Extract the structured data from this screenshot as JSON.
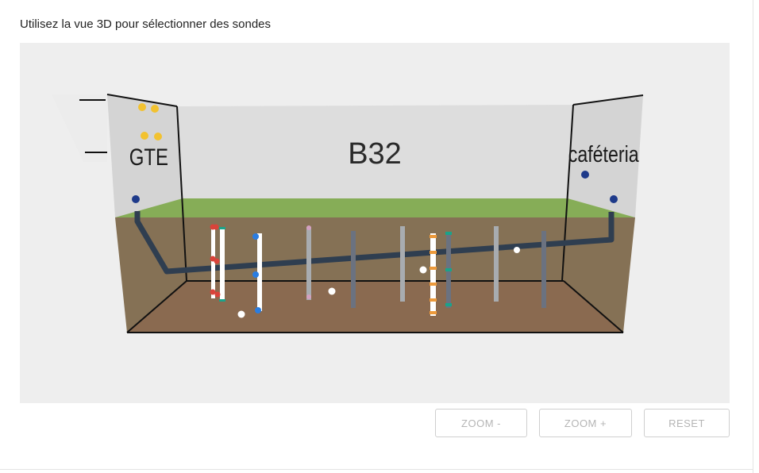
{
  "instruction": "Utilisez la vue 3D pour sélectionner des sondes",
  "scene": {
    "room_label": "B32",
    "left_label": "GTE",
    "right_label": "caféteria"
  },
  "toolbar": {
    "zoom_out_label": "ZOOM -",
    "zoom_in_label": "ZOOM +",
    "reset_label": "RESET"
  },
  "colors": {
    "viewport_bg": "#eeeeee",
    "wall": "#d6d6d6",
    "grass": "#8ab05a",
    "soil": "#8c7256",
    "pipe": "#2f3e50",
    "marker_yellow": "#f2c230",
    "marker_blue": "#1e3a8a",
    "probe_white": "#ffffff",
    "probe_red": "#d9433a",
    "probe_teal": "#1aa38a",
    "probe_blue": "#2a7de1",
    "probe_pink": "#d3a0c0",
    "probe_grey": "#a8acb0",
    "probe_dark": "#6b7280",
    "probe_orange": "#ec9a3c"
  }
}
